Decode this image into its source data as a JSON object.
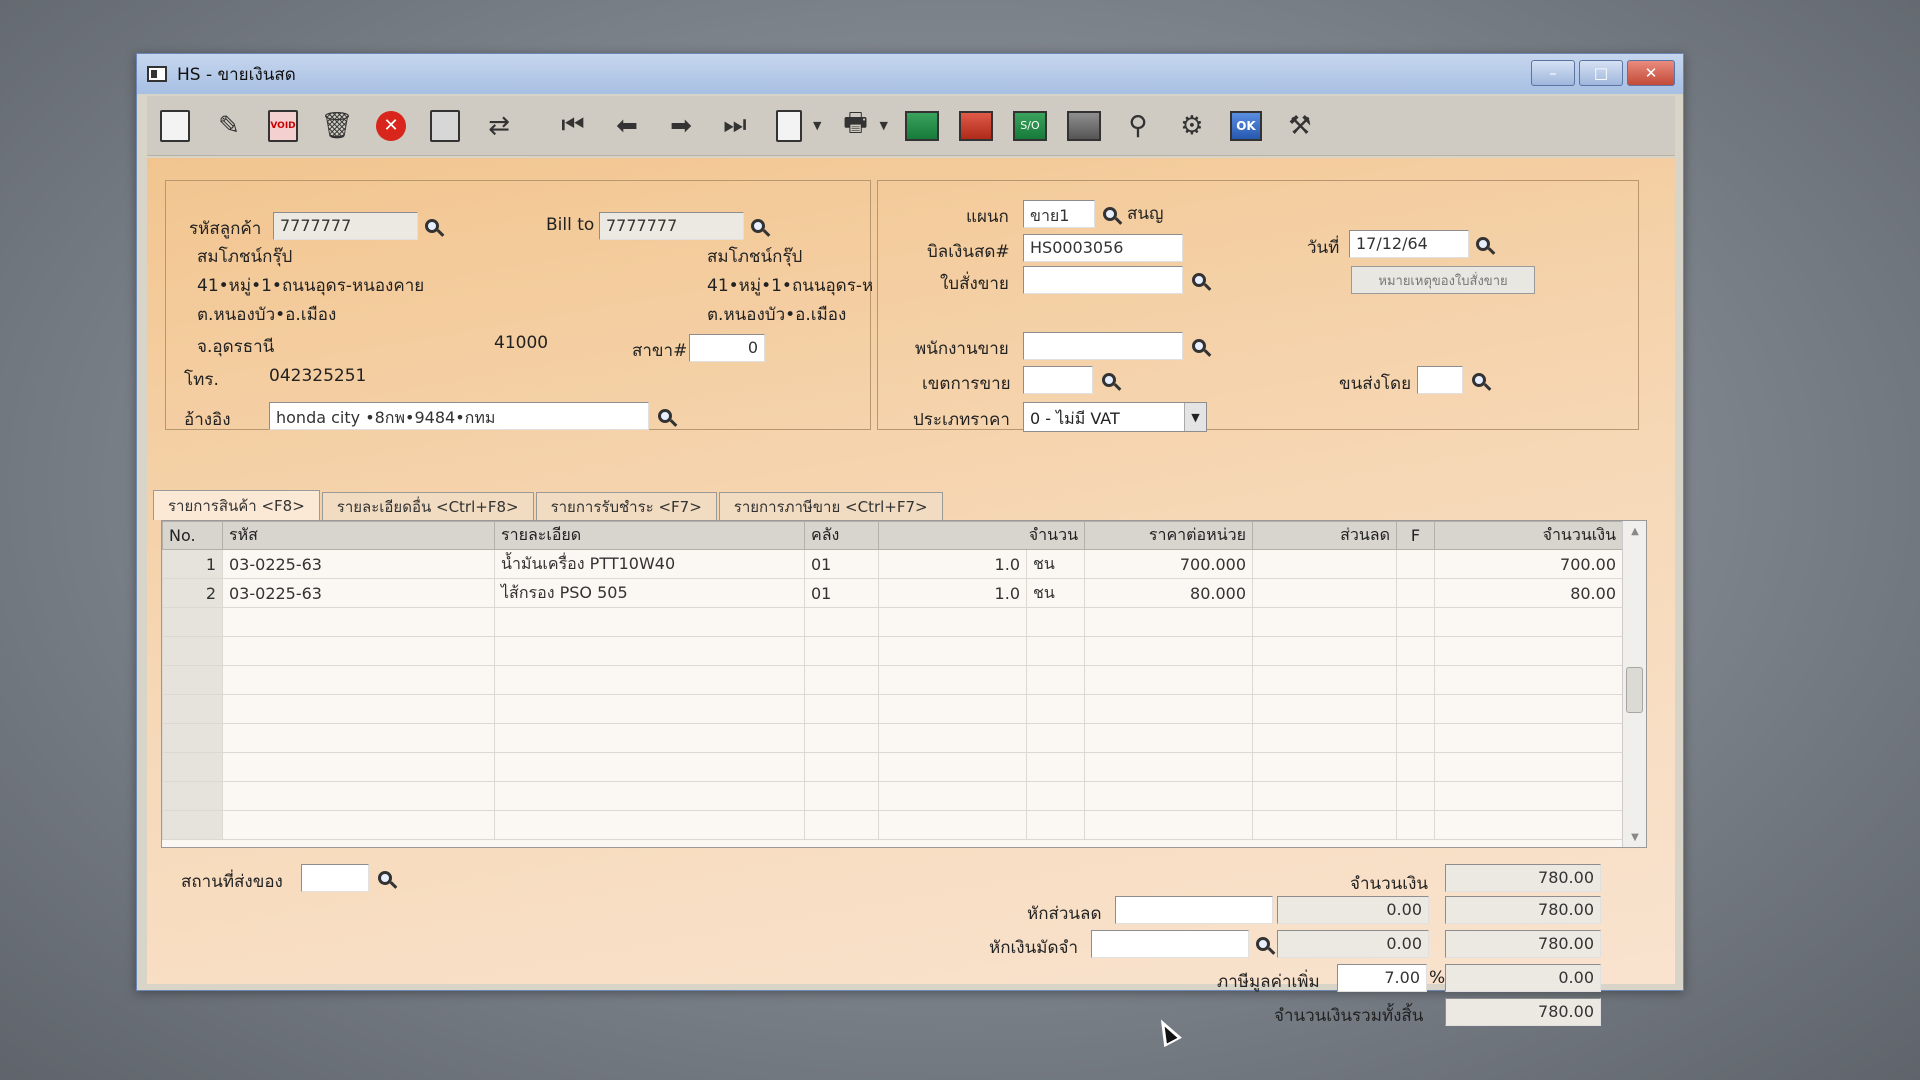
{
  "window": {
    "title": "HS - ขายเงินสด",
    "controls": [
      "–",
      "□",
      "✕"
    ]
  },
  "toolbar": {
    "icons": [
      "new-document-icon",
      "edit-icon",
      "void-icon",
      "trash-icon",
      "cancel-icon",
      "save-icon",
      "reorder-icon",
      "first-record-icon",
      "previous-record-icon",
      "next-record-icon",
      "last-record-icon",
      "search-doc-icon",
      "print-icon",
      "sheet-green-icon",
      "sheet-red-icon",
      "so-icon",
      "calendar-icon",
      "approve-ok-icon",
      "tools-icon",
      "ok-doc-icon",
      "settings-doc-icon"
    ],
    "void_label": "VOID",
    "so_label": "S/O",
    "ok_label": "OK"
  },
  "customer": {
    "code_label": "รหัสลูกค้า",
    "code_value": "7777777",
    "name": "สมโภชน์กรุ๊ป",
    "addr1": "41•หมู่•1•ถนนอุดร-หนองคาย",
    "addr2": "ต.หนองบัว•อ.เมือง",
    "addr3": "จ.อุดรธานี",
    "zip": "41000",
    "phone_label": "โทร.",
    "phone": "042325251",
    "ref_label": "อ้างอิง",
    "ref_value": "honda city •8กพ•9484•กทม"
  },
  "bill_to": {
    "label": "Bill to",
    "value": "7777777",
    "name": "สมโภชน์กรุ๊ป",
    "addr1": "41•หมู่•1•ถนนอุดร-ห",
    "addr2": "ต.หนองบัว•อ.เมือง",
    "branch_label": "สาขา#",
    "branch_value": "0"
  },
  "doc": {
    "dept_label": "แผนก",
    "dept_value": "ขาย1",
    "dept_name": "สนญ",
    "bill_label": "บิลเงินสด#",
    "bill_value": "HS0003056",
    "date_label": "วันที่",
    "date_value": "17/12/64",
    "so_label": "ใบสั่งขาย",
    "so_value": "",
    "so_note_button": "หมายเหตุของใบสั่งขาย",
    "salesman_label": "พนักงานขาย",
    "salesman_value": "",
    "area_label": "เขตการขาย",
    "area_value": "",
    "ship_label": "ขนส่งโดย",
    "ship_value": "",
    "price_type_label": "ประเภทราคา",
    "price_type_value": "0 - ไม่มี VAT"
  },
  "tabs": [
    {
      "label": "รายการสินค้า <F8>"
    },
    {
      "label": "รายละเอียดอื่น <Ctrl+F8>"
    },
    {
      "label": "รายการรับชำระ <F7>"
    },
    {
      "label": "รายการภาษีขาย <Ctrl+F7>"
    }
  ],
  "grid": {
    "columns": [
      "No.",
      "รหัส",
      "รายละเอียด",
      "คลัง",
      "จำนวน",
      "ราคาต่อหน่วย",
      "ส่วนลด",
      "F",
      "จำนวนเงิน"
    ],
    "rows": [
      {
        "no": "1",
        "code": "03-0225-63",
        "desc": "น้ำมันเครื่อง PTT10W40",
        "wh": "01",
        "qty": "1.0",
        "unit": "ชน",
        "price": "700.000",
        "disc": "",
        "f": "",
        "amount": "700.00"
      },
      {
        "no": "2",
        "code": "03-0225-63",
        "desc": "ไส้กรอง PSO 505",
        "wh": "01",
        "qty": "1.0",
        "unit": "ชน",
        "price": "80.000",
        "disc": "",
        "f": "",
        "amount": "80.00"
      }
    ]
  },
  "footer": {
    "ship_place_label": "สถานที่ส่งของ",
    "ship_place_value": "",
    "amount_label": "จำนวนเงิน",
    "amount_value": "780.00",
    "discount_label": "หักส่วนลด",
    "discount_input": "",
    "discount_value": "0.00",
    "discount_total": "780.00",
    "deposit_label": "หักเงินมัดจำ",
    "deposit_input": "",
    "deposit_value": "0.00",
    "deposit_total": "780.00",
    "vat_label": "ภาษีมูลค่าเพิ่ม",
    "vat_rate": "7.00",
    "vat_pct": "%",
    "vat_value": "0.00",
    "grand_total_label": "จำนวนเงินรวมทั้งสิ้น",
    "grand_total_value": "780.00"
  }
}
